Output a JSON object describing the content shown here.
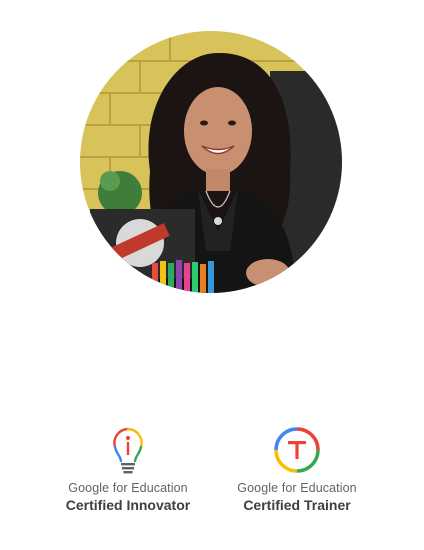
{
  "profile": {
    "photo_icon": "person-portrait"
  },
  "badges": [
    {
      "icon": "lightbulb-icon",
      "line1": "Google for Education",
      "line2": "Certified Innovator"
    },
    {
      "icon": "trainer-ring-icon",
      "line1": "Google for Education",
      "line2": "Certified Trainer"
    }
  ],
  "colors": {
    "google_blue": "#4285F4",
    "google_red": "#EA4335",
    "google_yellow": "#FBBC04",
    "google_green": "#34A853",
    "text_gray": "#5f6368"
  }
}
